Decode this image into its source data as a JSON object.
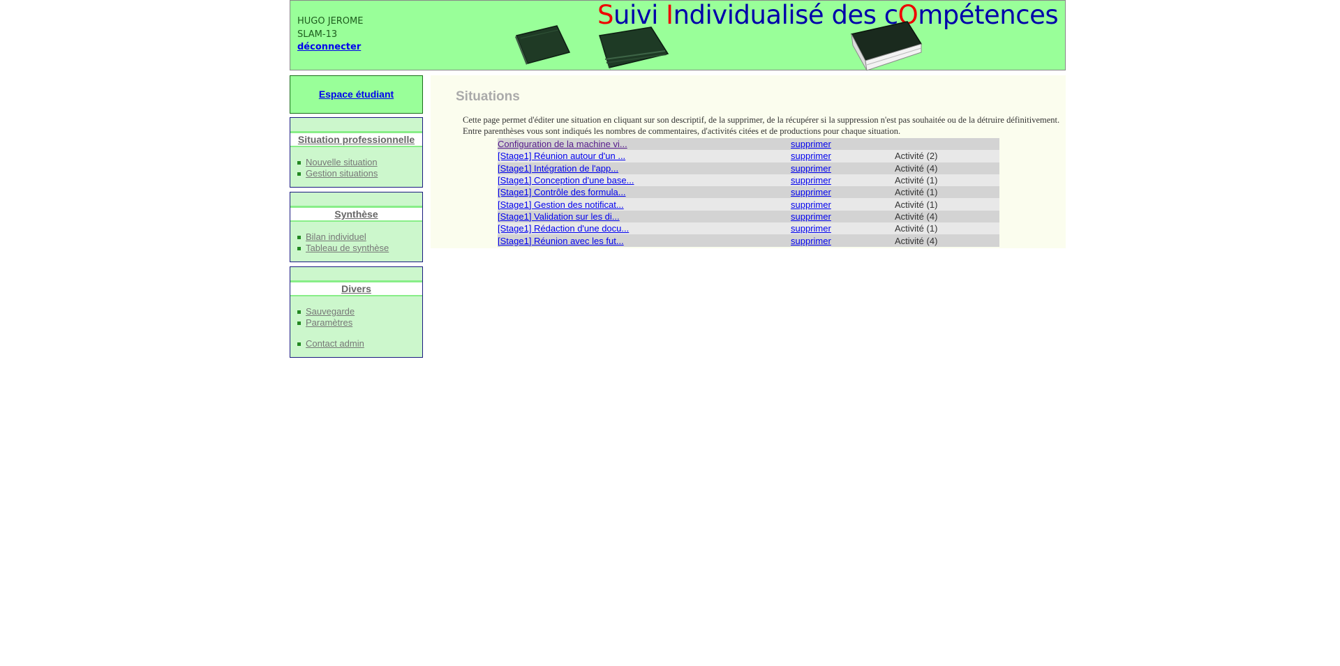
{
  "header": {
    "user_name": "HUGO JEROME",
    "class_name": "SLAM-13",
    "logout_label": "déconnecter",
    "title_parts": [
      {
        "text": "S",
        "red": true
      },
      {
        "text": "uivi ",
        "red": false
      },
      {
        "text": "I",
        "red": true
      },
      {
        "text": "ndividualisé des c",
        "red": false
      },
      {
        "text": "O",
        "red": true
      },
      {
        "text": "mpétences",
        "red": false
      }
    ]
  },
  "sidebar": {
    "espace_label": "Espace étudiant",
    "situation": {
      "title": "Situation professionnelle",
      "items": [
        "Nouvelle situation",
        "Gestion situations"
      ]
    },
    "synthese": {
      "title": "Synthèse",
      "items": [
        "Bilan individuel",
        "Tableau de synthèse"
      ]
    },
    "divers": {
      "title": "Divers",
      "items": [
        "Sauvegarde",
        "Paramètres"
      ],
      "contact": "Contact admin"
    }
  },
  "main": {
    "title": "Situations",
    "description": "Cette page permet d'éditer une situation en cliquant sur son descriptif, de la supprimer, de la récupérer si la suppression n'est pas souhaitée ou de la détruire définitivement. Entre parenthèses vous sont indiqués les nombres de commentaires, d'activités citées et de productions pour chaque situation.",
    "situations": [
      {
        "title": "Configuration de la machine vi...",
        "action": "supprimer",
        "activity": "",
        "visited": true
      },
      {
        "title": "[Stage1] Réunion autour d'un ...",
        "action": "supprimer",
        "activity": "Activité (2)",
        "visited": false
      },
      {
        "title": "[Stage1] Intégration de l'app...",
        "action": "supprimer",
        "activity": "Activité (4)",
        "visited": false
      },
      {
        "title": "[Stage1] Conception d'une base...",
        "action": "supprimer",
        "activity": "Activité (1)",
        "visited": false
      },
      {
        "title": "[Stage1] Contrôle des formula...",
        "action": "supprimer",
        "activity": "Activité (1)",
        "visited": false
      },
      {
        "title": "[Stage1] Gestion des notificat...",
        "action": "supprimer",
        "activity": "Activité (1)",
        "visited": false
      },
      {
        "title": "[Stage1] Validation sur les di...",
        "action": "supprimer",
        "activity": "Activité (4)",
        "visited": false
      },
      {
        "title": "[Stage1] Rédaction d'une docu...",
        "action": "supprimer",
        "activity": "Activité (1)",
        "visited": false
      },
      {
        "title": "[Stage1] Réunion avec les fut...",
        "action": "supprimer",
        "activity": "Activité (4)",
        "visited": false
      }
    ]
  },
  "colors": {
    "header_bg": "#99ff99",
    "sidebar_bg": "#ccf7cc",
    "main_bg": "#fbfdee",
    "title_blue": "#0000aa",
    "title_red": "#ee0000",
    "link": "#0000ee"
  },
  "icons": [
    "binder-icon",
    "binder-stack-icon",
    "book-icon",
    "bullet-icon"
  ]
}
